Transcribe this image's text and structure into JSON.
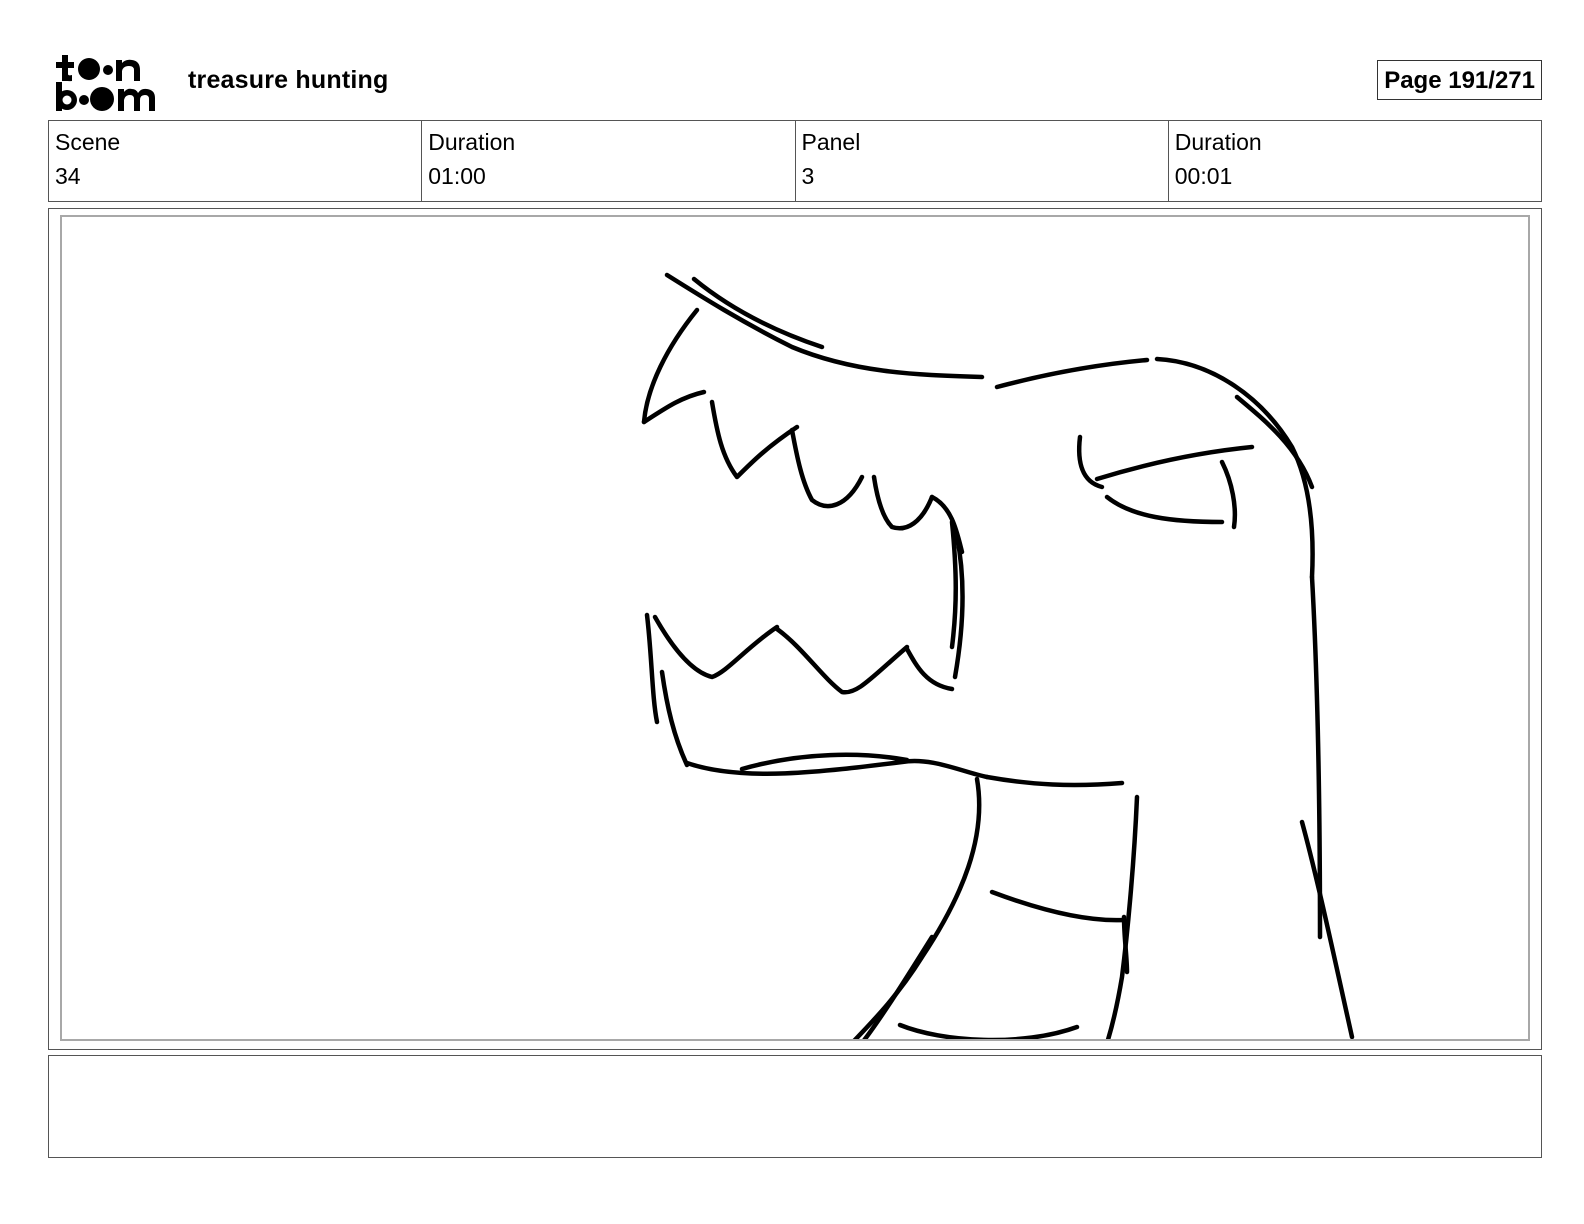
{
  "header": {
    "logo_text": [
      "toon",
      "boom"
    ],
    "project_title": "treasure hunting",
    "page_label": "Page 191/271"
  },
  "info": [
    {
      "label": "Scene",
      "value": "34"
    },
    {
      "label": "Duration",
      "value": "01:00"
    },
    {
      "label": "Panel",
      "value": "3"
    },
    {
      "label": "Duration",
      "value": "00:01"
    }
  ],
  "panel": {
    "sketch_icon": "dinosaur-head-sketch"
  },
  "notes": {
    "text": ""
  }
}
